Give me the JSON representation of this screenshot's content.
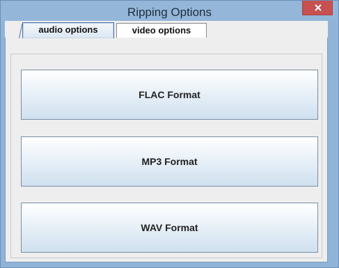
{
  "window": {
    "title": "Ripping Options",
    "close_icon": "close-icon"
  },
  "tabs": [
    {
      "label": "audio options",
      "selected": true
    },
    {
      "label": "video options",
      "selected": false
    }
  ],
  "formats": [
    {
      "label": "FLAC Format"
    },
    {
      "label": "MP3 Format"
    },
    {
      "label": "WAV Format"
    }
  ],
  "colors": {
    "titlebar": "#93b6d9",
    "close_button": "#c75050",
    "client_background": "#eeeeee",
    "selected_tab_border": "#4d72a3"
  }
}
